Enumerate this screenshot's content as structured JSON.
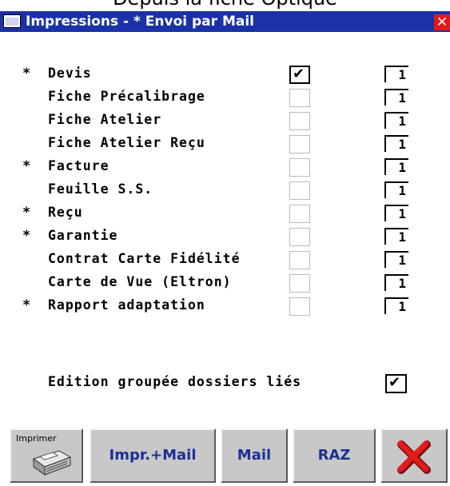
{
  "context_text": "Depuis la fiche Optique",
  "window": {
    "title": "Impressions - * Envoi par Mail",
    "close_glyph": "✕"
  },
  "items": [
    {
      "star": "*",
      "label": "Devis",
      "checked": true,
      "qty": "1"
    },
    {
      "star": "",
      "label": "Fiche Précalibrage",
      "checked": false,
      "qty": "1"
    },
    {
      "star": "",
      "label": "Fiche Atelier",
      "checked": false,
      "qty": "1"
    },
    {
      "star": "",
      "label": "Fiche Atelier Reçu",
      "checked": false,
      "qty": "1"
    },
    {
      "star": "*",
      "label": "Facture",
      "checked": false,
      "qty": "1"
    },
    {
      "star": "",
      "label": "Feuille S.S.",
      "checked": false,
      "qty": "1"
    },
    {
      "star": "*",
      "label": "Reçu",
      "checked": false,
      "qty": "1"
    },
    {
      "star": "*",
      "label": "Garantie",
      "checked": false,
      "qty": "1"
    },
    {
      "star": "",
      "label": "Contrat Carte Fidélité",
      "checked": false,
      "qty": "1"
    },
    {
      "star": "",
      "label": "Carte de Vue (Eltron)",
      "checked": false,
      "qty": "1"
    },
    {
      "star": "*",
      "label": "Rapport adaptation",
      "checked": false,
      "qty": "1"
    }
  ],
  "grouped_edition": {
    "label": "Edition groupée dossiers liés",
    "checked": true
  },
  "buttons": {
    "print": {
      "label": "Imprimer",
      "icon": "printer-icon"
    },
    "print_mail": {
      "label": "Impr.+Mail"
    },
    "mail": {
      "label": "Mail"
    },
    "reset": {
      "label": "RAZ"
    },
    "cancel": {
      "icon": "red-x-icon"
    }
  },
  "colors": {
    "titlebar": "#1a31a8",
    "button_text": "#1d2f93",
    "cancel_x": "#e31b1b"
  }
}
